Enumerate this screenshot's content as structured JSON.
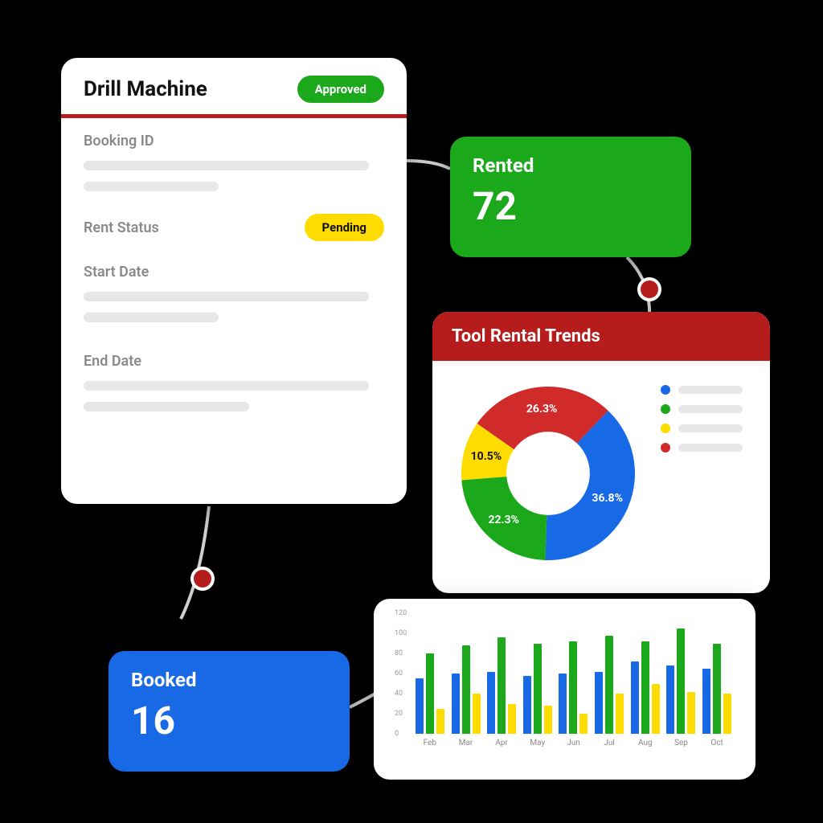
{
  "colors": {
    "green": "#1ba91b",
    "blue": "#1869e6",
    "yellow": "#ffdc00",
    "red": "#d02a2a",
    "dark_red": "#b71c1c"
  },
  "drill_card": {
    "title": "Drill Machine",
    "approved_badge": "Approved",
    "fields": {
      "booking_id": "Booking ID",
      "rent_status": "Rent Status",
      "rent_status_badge": "Pending",
      "start_date": "Start Date",
      "end_date": "End Date"
    }
  },
  "tiles": {
    "rented": {
      "label": "Rented",
      "value": "72"
    },
    "booked": {
      "label": "Booked",
      "value": "16"
    }
  },
  "trends_card": {
    "title": "Tool Rental Trends"
  },
  "chart_data": [
    {
      "type": "pie",
      "title": "Tool Rental Trends",
      "series": [
        {
          "name": "blue",
          "value": 36.8,
          "label": "36.8%",
          "color": "#1869e6"
        },
        {
          "name": "green",
          "value": 22.3,
          "label": "22.3%",
          "color": "#1ba91b"
        },
        {
          "name": "yellow",
          "value": 10.5,
          "label": "10.5%",
          "color": "#ffdc00"
        },
        {
          "name": "red",
          "value": 26.3,
          "label": "26.3%",
          "color": "#d02a2a"
        }
      ],
      "hole": 0.48,
      "legend_position": "right"
    },
    {
      "type": "bar",
      "title": "",
      "ylim": [
        0,
        120
      ],
      "yticks": [
        0,
        20,
        40,
        60,
        80,
        100,
        120
      ],
      "categories": [
        "Feb",
        "Mar",
        "Apr",
        "May",
        "Jun",
        "Jul",
        "Aug",
        "Sep",
        "Oct"
      ],
      "series": [
        {
          "name": "blue",
          "color": "#1869e6",
          "values": [
            55,
            60,
            62,
            58,
            60,
            62,
            72,
            68,
            65
          ]
        },
        {
          "name": "green",
          "color": "#1ba91b",
          "values": [
            80,
            88,
            96,
            90,
            92,
            98,
            92,
            105,
            90
          ]
        },
        {
          "name": "yellow",
          "color": "#ffdc00",
          "values": [
            25,
            40,
            30,
            28,
            20,
            40,
            50,
            42,
            40
          ]
        }
      ]
    }
  ]
}
